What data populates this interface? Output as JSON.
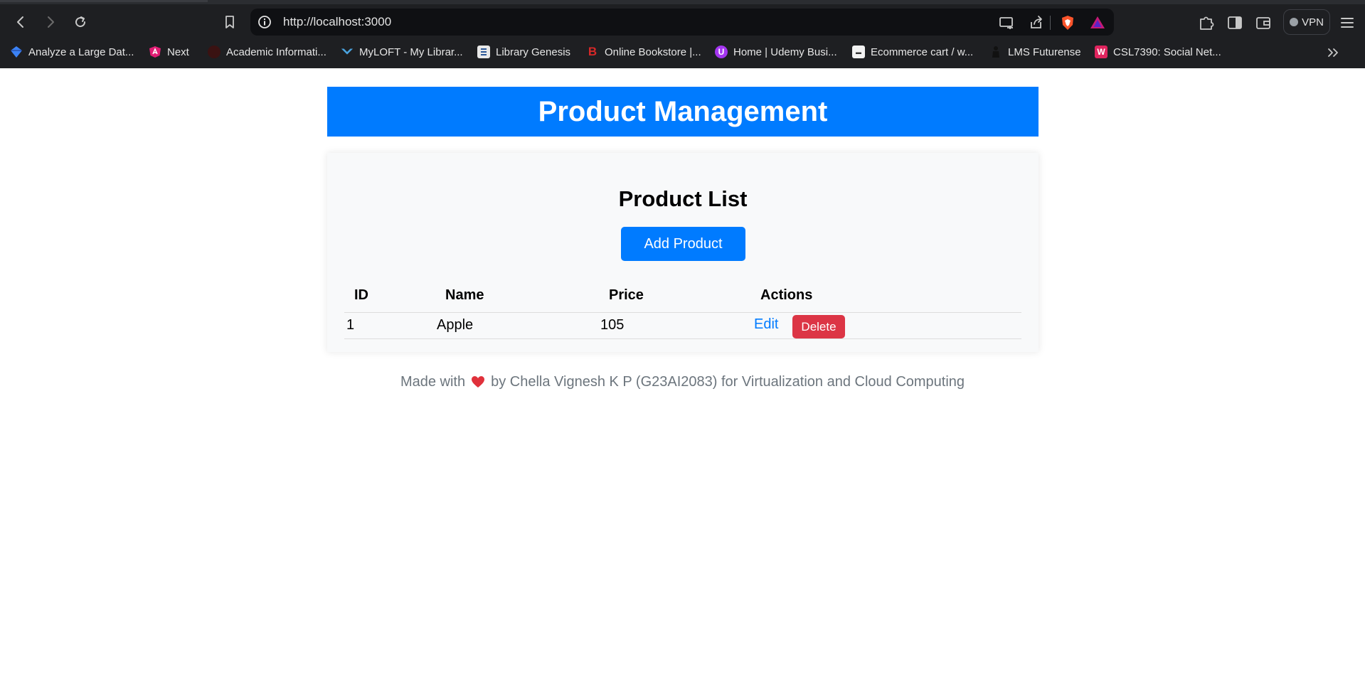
{
  "browser": {
    "url": "http://localhost:3000",
    "vpn_label": "VPN",
    "bookmarks": [
      {
        "label": "Analyze a Large Dat...",
        "icon": "diamond-icon",
        "color": "#3b82f6"
      },
      {
        "label": "Next",
        "icon": "angular-icon",
        "color": "#e11d74"
      },
      {
        "label": "Academic Informati...",
        "icon": "circle-icon",
        "color": "#5a1a1a"
      },
      {
        "label": "MyLOFT - My Librar...",
        "icon": "myloft-icon",
        "color": "#4aa3df"
      },
      {
        "label": "Library Genesis",
        "icon": "book-icon",
        "color": "#e8e8e8"
      },
      {
        "label": "Online Bookstore |...",
        "icon": "b-icon",
        "color": "#d62828"
      },
      {
        "label": "Home | Udemy Busi...",
        "icon": "udemy-icon",
        "color": "#a435f0"
      },
      {
        "label": "Ecommerce cart / w...",
        "icon": "cart-icon",
        "color": "#f2f2f2"
      },
      {
        "label": "LMS Futurense",
        "icon": "person-icon",
        "color": "#222222"
      },
      {
        "label": "CSL7390: Social Net...",
        "icon": "w-icon",
        "color": "#e0245e"
      }
    ]
  },
  "app": {
    "title": "Product Management",
    "list_title": "Product List",
    "add_button": "Add Product",
    "columns": [
      "ID",
      "Name",
      "Price",
      "Actions"
    ],
    "rows": [
      {
        "id": "1",
        "name": "Apple",
        "price": "105",
        "edit": "Edit",
        "delete": "Delete"
      }
    ],
    "footer_pre": "Made with",
    "footer_post": "by Chella Vignesh K P (G23AI2083) for Virtualization and Cloud Computing"
  },
  "colors": {
    "primary": "#007bff",
    "danger": "#dc3545",
    "muted": "#6c757d",
    "heart": "#e0313b"
  }
}
